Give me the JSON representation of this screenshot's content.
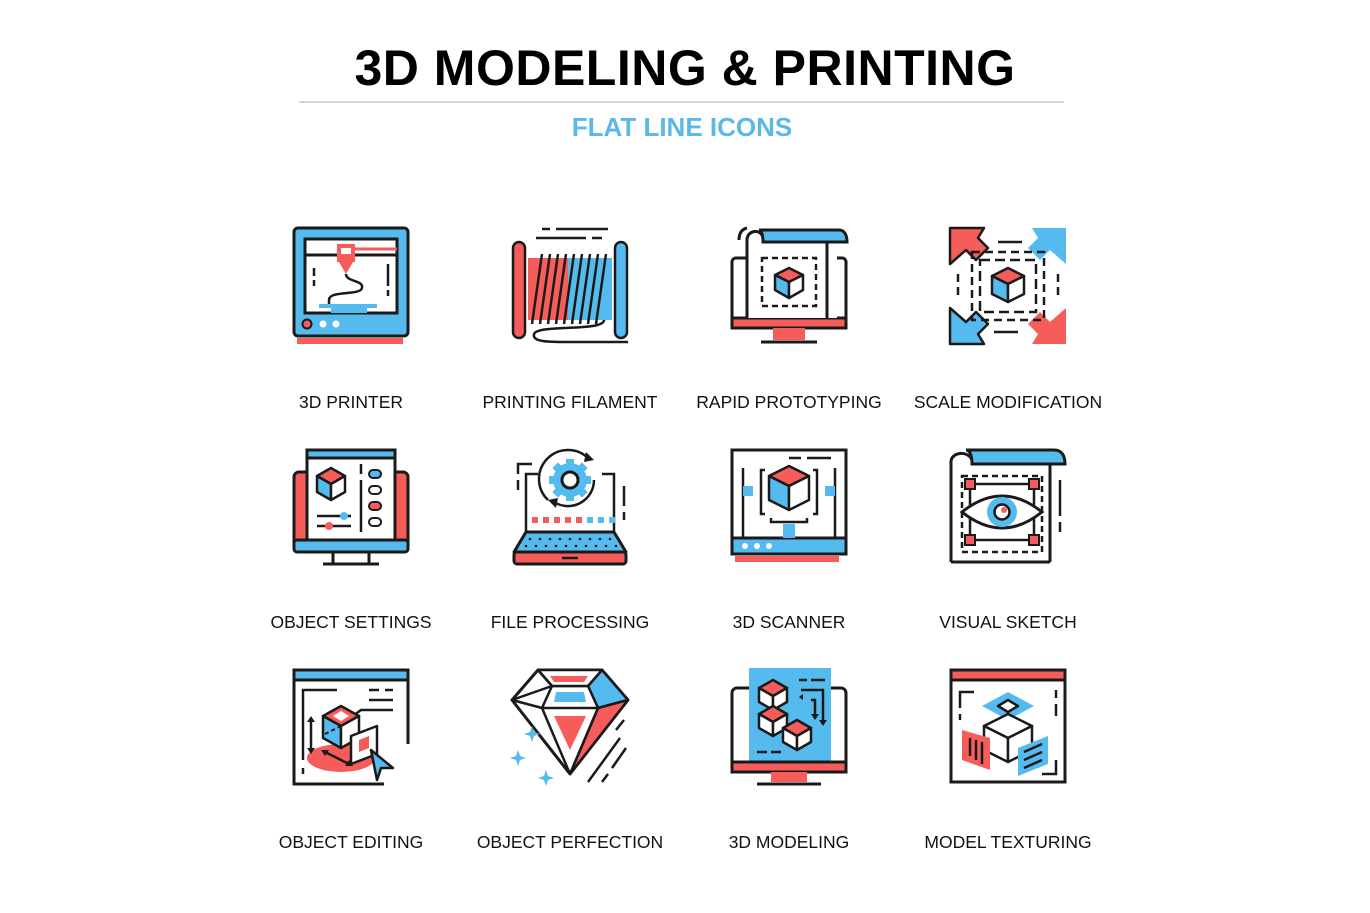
{
  "header": {
    "title": "3D MODELING & PRINTING",
    "subtitle": "FLAT LINE ICONS"
  },
  "colors": {
    "accent_blue": "#55bbee",
    "accent_red": "#f65d5a",
    "outline": "#1a1a1a",
    "subtitle": "#5bb8e8",
    "rule": "#d4d4d4"
  },
  "icons": [
    {
      "label": "3D PRINTER",
      "icon": "3d-printer-icon"
    },
    {
      "label": "PRINTING FILAMENT",
      "icon": "filament-spool-icon"
    },
    {
      "label": "RAPID PROTOTYPING",
      "icon": "prototyping-monitor-icon"
    },
    {
      "label": "SCALE MODIFICATION",
      "icon": "scale-arrows-icon"
    },
    {
      "label": "OBJECT SETTINGS",
      "icon": "object-settings-icon"
    },
    {
      "label": "FILE PROCESSING",
      "icon": "file-processing-laptop-icon"
    },
    {
      "label": "3D SCANNER",
      "icon": "3d-scanner-icon"
    },
    {
      "label": "VISUAL SKETCH",
      "icon": "visual-sketch-eye-icon"
    },
    {
      "label": "OBJECT EDITING",
      "icon": "object-editing-icon"
    },
    {
      "label": "OBJECT PERFECTION",
      "icon": "diamond-icon"
    },
    {
      "label": "3D MODELING",
      "icon": "3d-modeling-cubes-icon"
    },
    {
      "label": "MODEL TEXTURING",
      "icon": "model-texturing-icon"
    }
  ]
}
